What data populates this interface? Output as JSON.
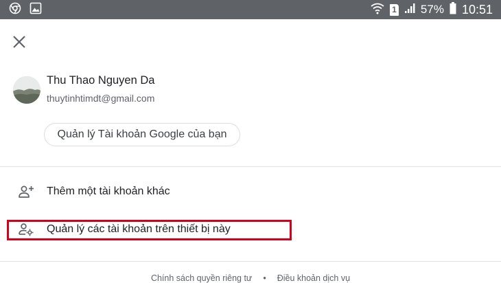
{
  "status_bar": {
    "battery_percent": "57%",
    "time": "10:51",
    "sim_label": "1",
    "left_icons": [
      "chrome-icon",
      "image-icon"
    ],
    "right_icons": [
      "wifi-icon",
      "sim-icon",
      "signal-icon",
      "battery-icon"
    ]
  },
  "account": {
    "name": "Thu Thao Nguyen Da",
    "email": "thuytinhtimdt@gmail.com",
    "manage_label": "Quản lý Tài khoản Google của bạn"
  },
  "menu": {
    "add_account_label": "Thêm một tài khoản khác",
    "manage_device_accounts_label": "Quản lý các tài khoản trên thiết bị này"
  },
  "footer": {
    "privacy_label": "Chính sách quyền riêng tư",
    "separator": "•",
    "terms_label": "Điều khoản dịch vụ"
  },
  "colors": {
    "status_bar_bg": "#5f6266",
    "highlight_border": "#d0021b",
    "text_primary": "#202124",
    "text_secondary": "#5f6368"
  }
}
